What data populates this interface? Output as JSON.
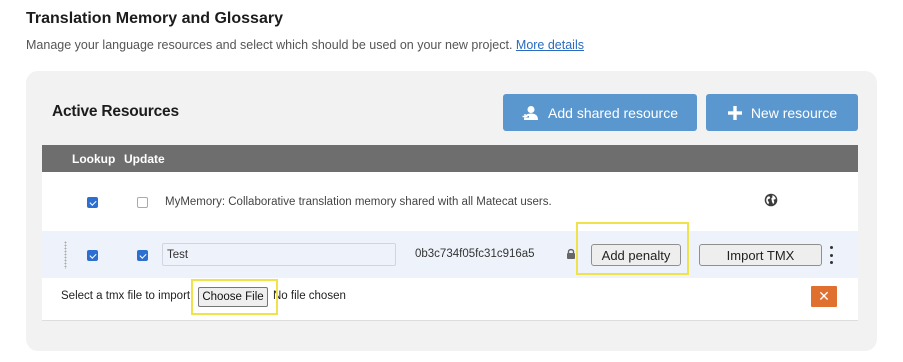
{
  "page": {
    "title": "Translation Memory and Glossary",
    "subtitle": "Manage your language resources and select which should be used on your new project.",
    "more_link": "More details"
  },
  "panel": {
    "title": "Active Resources",
    "add_shared_label": "Add shared resource",
    "new_resource_label": "New resource"
  },
  "table": {
    "headers": [
      "Lookup",
      "Update"
    ],
    "rows": [
      {
        "lookup": true,
        "update": false,
        "description": "MyMemory: Collaborative translation memory shared with all Matecat users.",
        "icon": "globe-icon"
      },
      {
        "lookup": true,
        "update": true,
        "name": "Test",
        "key": "0b3c734f05fc31c916a5",
        "key_icon": "lock-icon",
        "penalty_label": "Add penalty",
        "import_label": "Import TMX",
        "menu_icon": "kebab-icon"
      }
    ]
  },
  "import_row": {
    "prompt": "Select a tmx file to import",
    "choose_file_label": "Choose File",
    "no_file_text": "No file chosen",
    "close_icon": "close-icon",
    "close_color": "#e0702f"
  },
  "colors": {
    "accent": "#5b97cf",
    "header_bg": "#6e6e6e",
    "checkbox": "#2d6fd0",
    "highlight": "#f0e24a"
  }
}
